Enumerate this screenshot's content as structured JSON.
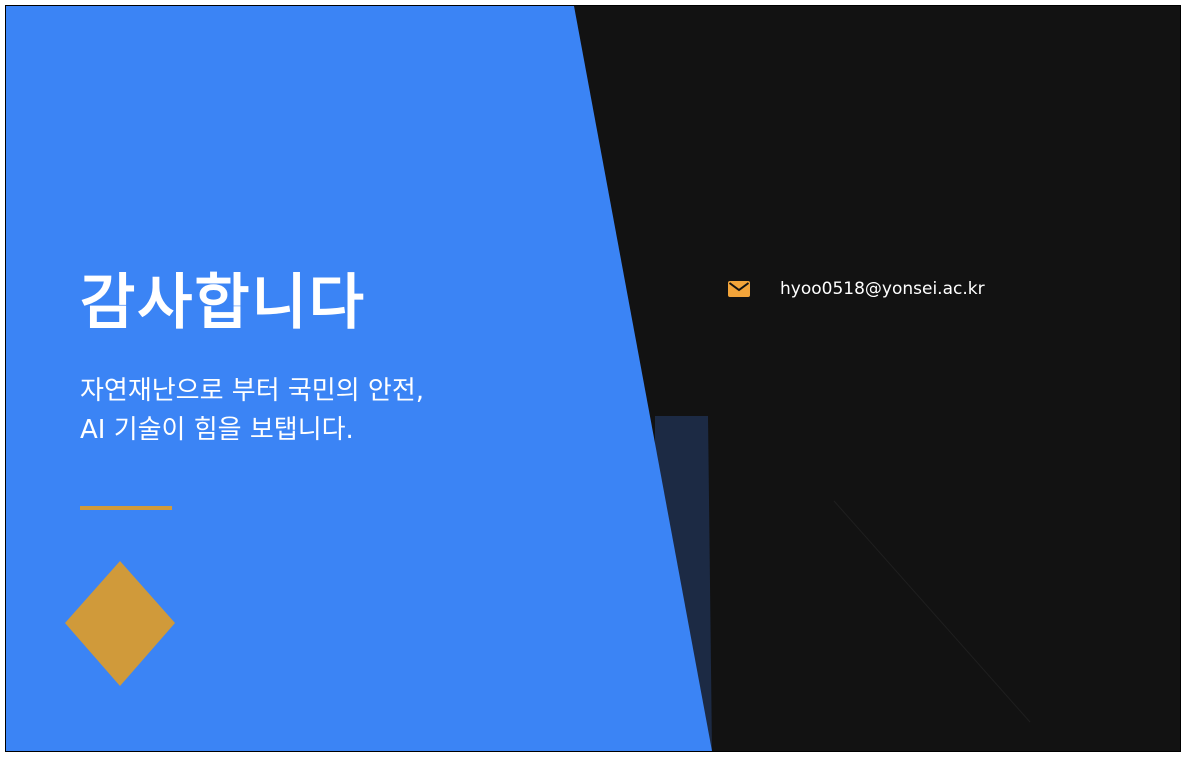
{
  "slide": {
    "title": "감사합니다",
    "subtitle_lines": [
      "자연재난으로 부터 국민의 안전,",
      "AI 기술이 힘을 보탭니다."
    ],
    "contact": {
      "icon": "mail-icon",
      "email": "hyoo0518@yonsei.ac.kr"
    }
  },
  "colors": {
    "blue_panel": "#3b84f5",
    "dark_background": "#121212",
    "navy_accent": "#1c2a44",
    "gold_accent": "#d09a3a",
    "mail_icon": "#f2a43a",
    "text": "#ffffff"
  }
}
